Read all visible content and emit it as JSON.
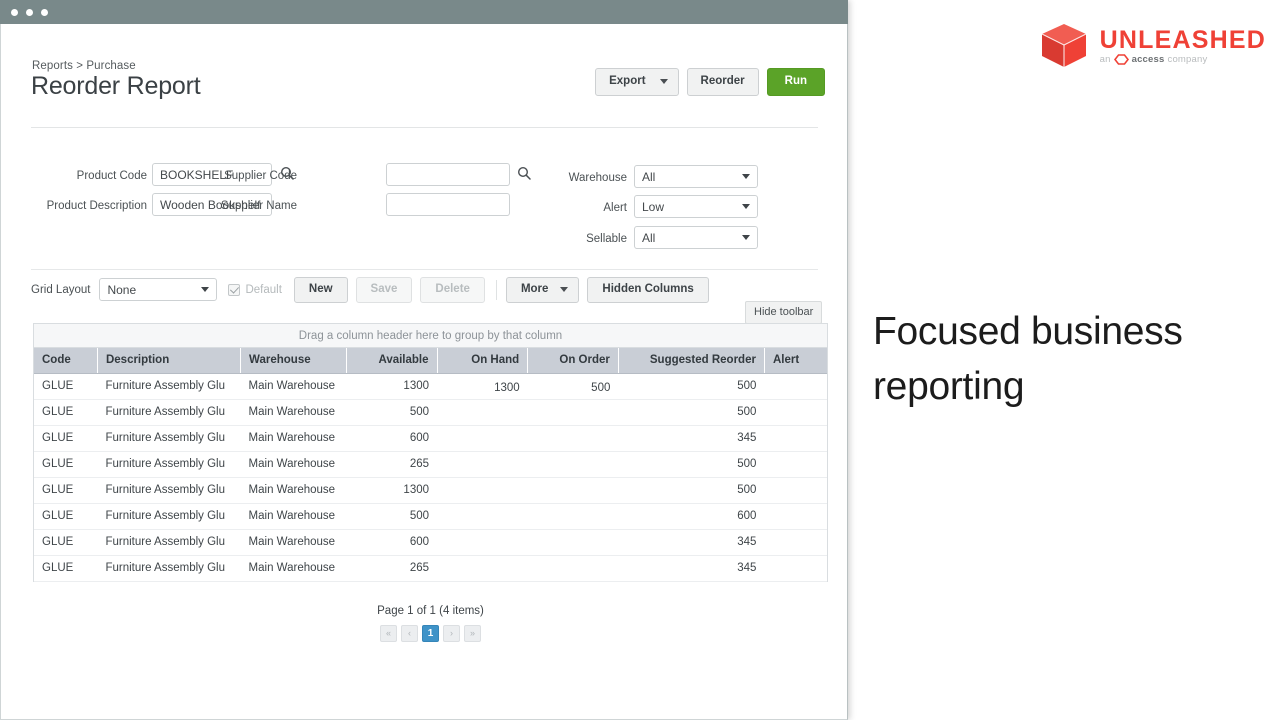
{
  "window": {
    "titlebar_dots": 3
  },
  "header": {
    "breadcrumb": "Reports > Purchase",
    "title": "Reorder Report",
    "export_label": "Export",
    "reorder_label": "Reorder",
    "run_label": "Run"
  },
  "filters": {
    "product_code_label": "Product Code",
    "product_code_value": "BOOKSHELF",
    "product_description_label": "Product Description",
    "product_description_value": "Wooden Bookshelf",
    "supplier_code_label": "Supplier Code",
    "supplier_code_value": "",
    "supplier_name_label": "Supplier Name",
    "supplier_name_value": "",
    "warehouse_label": "Warehouse",
    "warehouse_value": "All",
    "alert_label": "Alert",
    "alert_value": "Low",
    "sellable_label": "Sellable",
    "sellable_value": "All"
  },
  "toolbar": {
    "grid_layout_label": "Grid Layout",
    "grid_layout_value": "None",
    "default_label": "Default",
    "new_label": "New",
    "save_label": "Save",
    "delete_label": "Delete",
    "more_label": "More",
    "hidden_columns_label": "Hidden Columns",
    "hide_toolbar_tooltip": "Hide toolbar"
  },
  "grid": {
    "group_hint": "Drag a column header here to group by that column",
    "columns": [
      {
        "label": "Code",
        "align": "left"
      },
      {
        "label": "Description",
        "align": "left"
      },
      {
        "label": "Warehouse",
        "align": "left"
      },
      {
        "label": "Available",
        "align": "right"
      },
      {
        "label": "On Hand",
        "align": "right"
      },
      {
        "label": "On Order",
        "align": "right"
      },
      {
        "label": "Suggested Reorder",
        "align": "right"
      },
      {
        "label": "Alert",
        "align": "left"
      }
    ],
    "rows": [
      {
        "code": "GLUE",
        "description": "Furniture Assembly Glu",
        "warehouse": "Main Warehouse",
        "available": "1300",
        "on_hand": "1300",
        "on_order": "500",
        "suggested_reorder": "500",
        "alert": ""
      },
      {
        "code": "GLUE",
        "description": "Furniture Assembly Glu",
        "warehouse": "Main Warehouse",
        "available": "500",
        "on_hand": "",
        "on_order": "",
        "suggested_reorder": "500",
        "alert": ""
      },
      {
        "code": "GLUE",
        "description": "Furniture Assembly Glu",
        "warehouse": "Main Warehouse",
        "available": "600",
        "on_hand": "",
        "on_order": "",
        "suggested_reorder": "345",
        "alert": ""
      },
      {
        "code": "GLUE",
        "description": "Furniture Assembly Glu",
        "warehouse": "Main Warehouse",
        "available": "265",
        "on_hand": "",
        "on_order": "",
        "suggested_reorder": "500",
        "alert": ""
      },
      {
        "code": "GLUE",
        "description": "Furniture Assembly Glu",
        "warehouse": "Main Warehouse",
        "available": "1300",
        "on_hand": "",
        "on_order": "",
        "suggested_reorder": "500",
        "alert": ""
      },
      {
        "code": "GLUE",
        "description": "Furniture Assembly Glu",
        "warehouse": "Main Warehouse",
        "available": "500",
        "on_hand": "",
        "on_order": "",
        "suggested_reorder": "600",
        "alert": ""
      },
      {
        "code": "GLUE",
        "description": "Furniture Assembly Glu",
        "warehouse": "Main Warehouse",
        "available": "600",
        "on_hand": "",
        "on_order": "",
        "suggested_reorder": "345",
        "alert": ""
      },
      {
        "code": "GLUE",
        "description": "Furniture Assembly Glu",
        "warehouse": "Main Warehouse",
        "available": "265",
        "on_hand": "",
        "on_order": "",
        "suggested_reorder": "345",
        "alert": ""
      }
    ]
  },
  "pager": {
    "summary": "Page 1 of 1 (4 items)",
    "first": "«",
    "prev": "‹",
    "current": "1",
    "next": "›",
    "last": "»"
  },
  "brand": {
    "name": "UNLEASHED",
    "tagline_prefix": "an",
    "tagline_mark": "access",
    "tagline_suffix": "company"
  },
  "marketing": {
    "headline": "Focused business reporting"
  },
  "colors": {
    "titlebar": "#79898a",
    "run_green": "#5ba328",
    "link_blue": "#3f93c8",
    "brand_red": "#ef4136",
    "header_gray": "#c9ced6"
  }
}
